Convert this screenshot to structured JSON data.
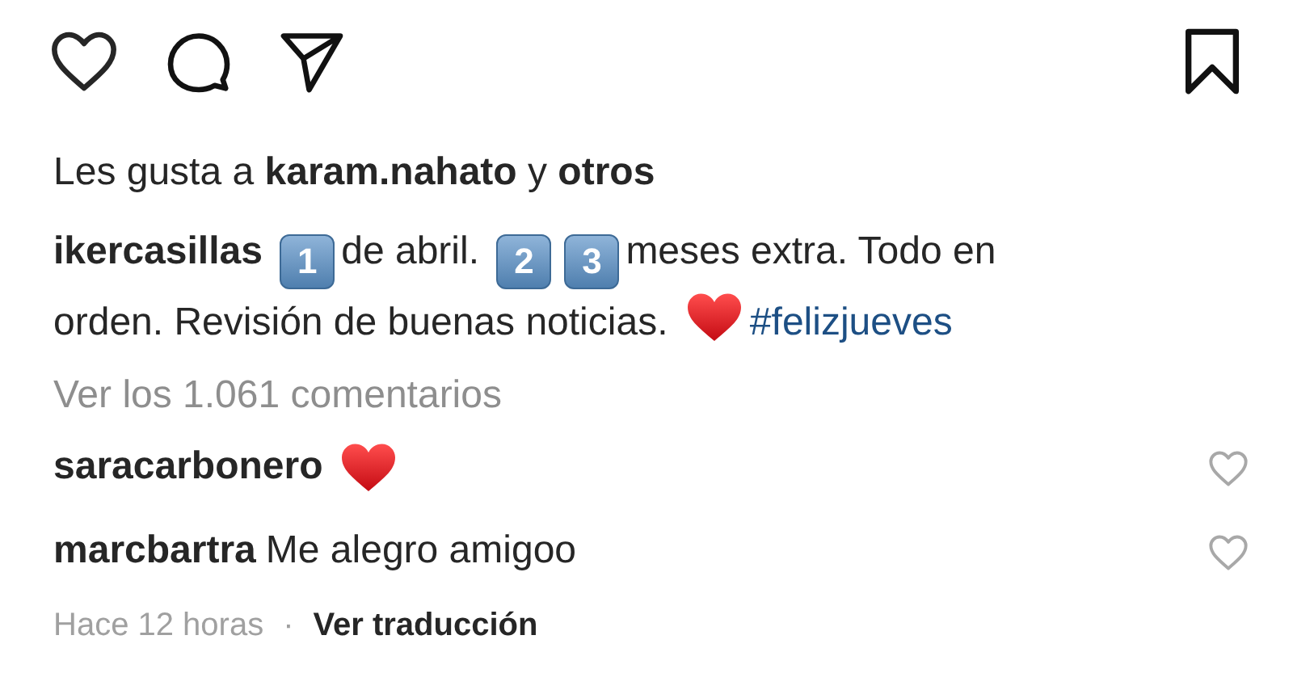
{
  "actions": {
    "liked": false,
    "saved": false
  },
  "likes": "Les gusta a **karam.nahato** y **otros**",
  "caption": {
    "username": "ikercasillas",
    "segments": [
      {
        "kind": "keycap",
        "text": "1"
      },
      {
        "kind": "text",
        "text": "de abril."
      },
      {
        "kind": "keycap",
        "text": "2"
      },
      {
        "kind": "keycap",
        "text": "3"
      },
      {
        "kind": "text",
        "text": "meses extra. Todo en"
      },
      {
        "kind": "text",
        "text": "orden. Revisión de buenas noticias."
      },
      {
        "kind": "heart"
      },
      {
        "kind": "hashtag",
        "text": "#felizjueves"
      }
    ]
  },
  "view_comments": "Ver los 1.061 comentarios",
  "comments": [
    {
      "username": "saracarbonero",
      "segments": [
        {
          "kind": "heart"
        }
      ],
      "liked": false
    },
    {
      "username": "marcbartra",
      "segments": [
        {
          "kind": "text",
          "text": "Me alegro amigoo"
        }
      ],
      "liked": false
    }
  ],
  "footer": {
    "time": "Hace 12 horas",
    "separator": "·",
    "link": "Ver traducción"
  }
}
